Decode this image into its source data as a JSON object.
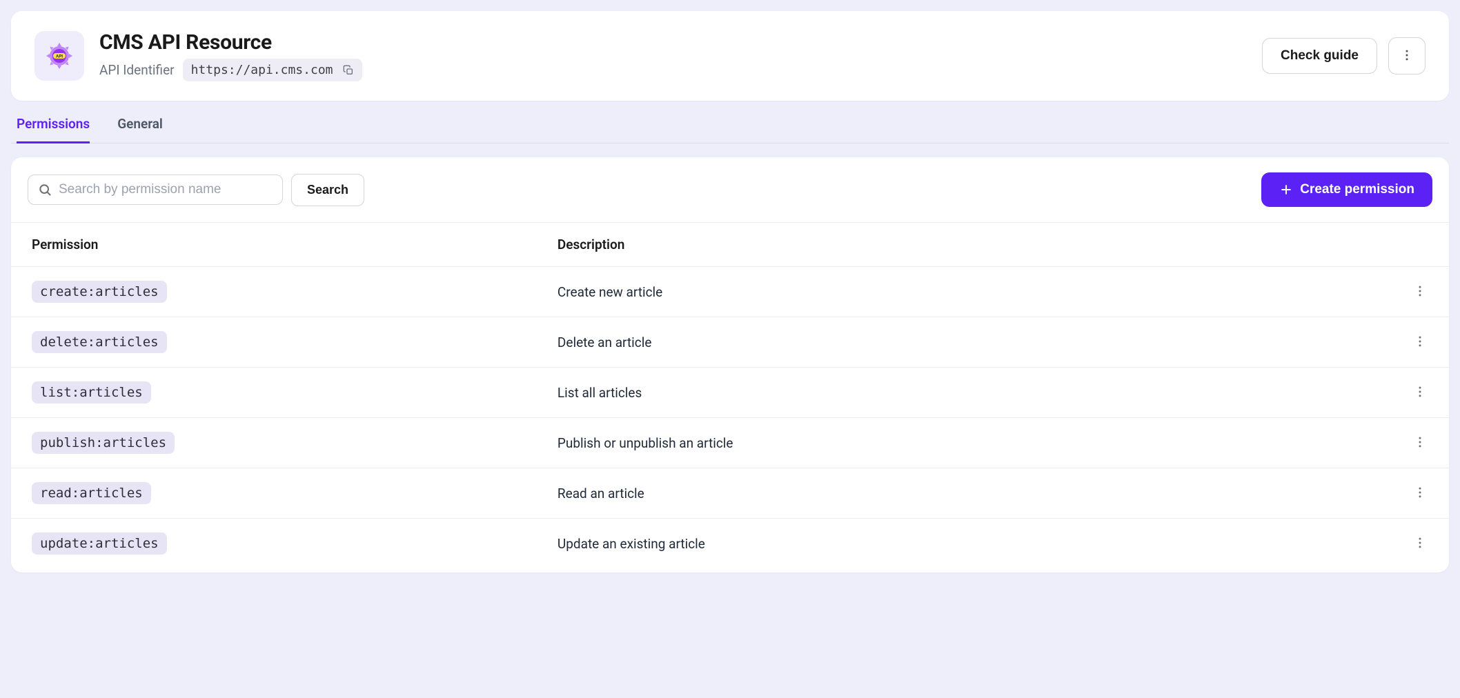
{
  "header": {
    "title": "CMS API Resource",
    "identifier_label": "API Identifier",
    "identifier_value": "https://api.cms.com",
    "check_guide_label": "Check guide"
  },
  "tabs": [
    {
      "label": "Permissions",
      "active": true
    },
    {
      "label": "General",
      "active": false
    }
  ],
  "toolbar": {
    "search_placeholder": "Search by permission name",
    "search_button_label": "Search",
    "create_button_label": "Create permission"
  },
  "table": {
    "columns": {
      "permission": "Permission",
      "description": "Description"
    },
    "rows": [
      {
        "permission": "create:articles",
        "description": "Create new article"
      },
      {
        "permission": "delete:articles",
        "description": "Delete an article"
      },
      {
        "permission": "list:articles",
        "description": "List all articles"
      },
      {
        "permission": "publish:articles",
        "description": "Publish or unpublish an article"
      },
      {
        "permission": "read:articles",
        "description": "Read an article"
      },
      {
        "permission": "update:articles",
        "description": "Update an existing article"
      }
    ]
  }
}
